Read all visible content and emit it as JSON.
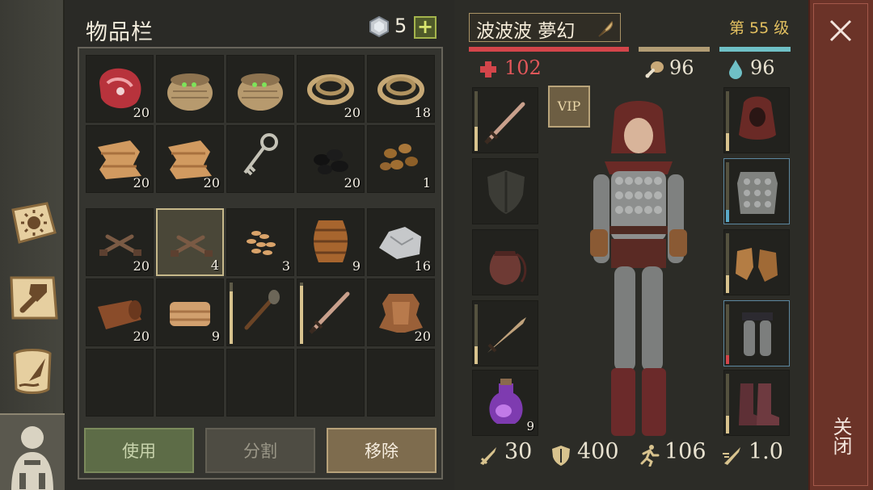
{
  "inventory": {
    "title": "物品栏",
    "gem_count": "5",
    "add_label": "+",
    "top_rows": [
      {
        "item": "raw-meat-icon",
        "count": "20"
      },
      {
        "item": "basket-icon",
        "count": ""
      },
      {
        "item": "basket-icon",
        "count": ""
      },
      {
        "item": "rope-icon",
        "count": "20"
      },
      {
        "item": "rope-icon",
        "count": "18"
      },
      {
        "item": "cloth-icon",
        "count": "20"
      },
      {
        "item": "cloth-icon",
        "count": "20"
      },
      {
        "item": "key-icon",
        "count": ""
      },
      {
        "item": "coal-icon",
        "count": "20"
      },
      {
        "item": "nuts-icon",
        "count": "1"
      }
    ],
    "bottom_rows": [
      {
        "item": "nails-icon",
        "count": "20"
      },
      {
        "item": "nails-icon",
        "count": "4",
        "selected": true
      },
      {
        "item": "seeds-icon",
        "count": "3"
      },
      {
        "item": "barrel-icon",
        "count": "9"
      },
      {
        "item": "iron-ore-icon",
        "count": "16"
      },
      {
        "item": "leather-roll-icon",
        "count": "20"
      },
      {
        "item": "folded-leather-icon",
        "count": "9"
      },
      {
        "item": "torch-icon",
        "count": "",
        "durability": 0.85
      },
      {
        "item": "sword-icon",
        "count": "",
        "durability": 0.95
      },
      {
        "item": "hide-icon",
        "count": "20"
      },
      {
        "item": "empty",
        "count": ""
      },
      {
        "item": "empty",
        "count": ""
      },
      {
        "item": "empty",
        "count": ""
      },
      {
        "item": "empty",
        "count": ""
      },
      {
        "item": "empty",
        "count": ""
      }
    ],
    "buttons": {
      "use": "使用",
      "split": "分割",
      "remove": "移除"
    }
  },
  "character": {
    "name": "波波波 夢幻",
    "level": "第 55 级",
    "hp": "102",
    "food": "96",
    "water": "96",
    "vip": "VIP",
    "left_slots": [
      {
        "item": "sword-icon",
        "count": "",
        "durability": 0.4,
        "dura_color": "#d8c38e"
      },
      {
        "item": "shield-placeholder-icon",
        "count": ""
      },
      {
        "item": "pouch-icon",
        "count": ""
      },
      {
        "item": "short-sword-icon",
        "count": "",
        "durability": 0.3,
        "dura_color": "#d8c38e"
      },
      {
        "item": "potion-icon",
        "count": "9"
      }
    ],
    "right_slots": [
      {
        "item": "hood-icon",
        "count": "",
        "durability": 0.3,
        "dura_color": "#d8c38e"
      },
      {
        "item": "chest-armor-icon",
        "count": "",
        "durability": 0.2,
        "dura_color": "#5aa9c8"
      },
      {
        "item": "gloves-icon",
        "count": "",
        "durability": 0.3,
        "dura_color": "#d8c38e"
      },
      {
        "item": "leg-armor-icon",
        "count": "",
        "durability": 0.15,
        "dura_color": "#d4454a"
      },
      {
        "item": "boots-icon",
        "count": "",
        "durability": 0.3,
        "dura_color": "#d8c38e"
      }
    ],
    "stats": {
      "attack": "30",
      "armor": "400",
      "speed": "106",
      "attack_speed": "1.0"
    }
  },
  "close_label": "关闭",
  "colors": {
    "hp": "#d3454a",
    "food": "#b19c74",
    "water": "#6fc0c6",
    "level": "#e3c060",
    "close_bg": "#6b3328"
  }
}
